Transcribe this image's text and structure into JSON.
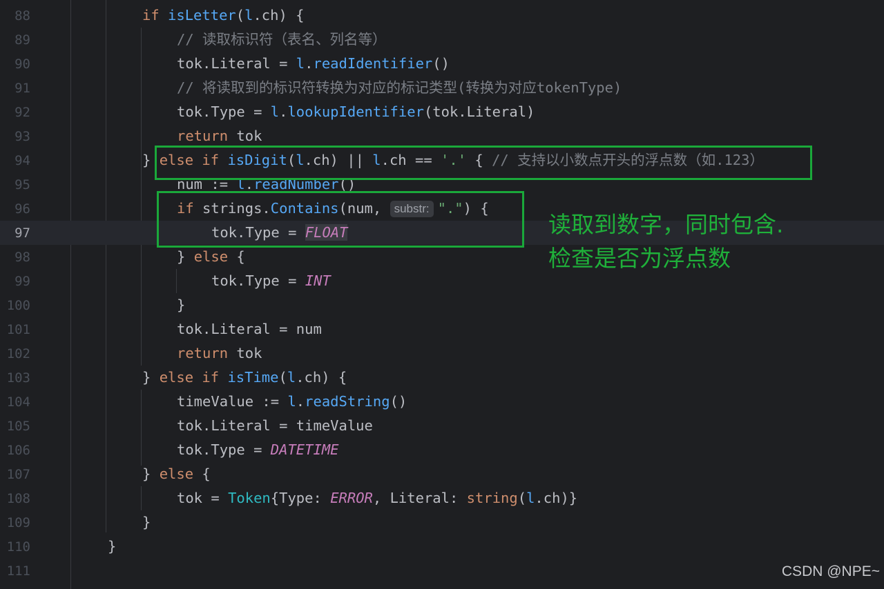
{
  "editor": {
    "line_numbers": [
      "88",
      "89",
      "90",
      "91",
      "92",
      "93",
      "94",
      "95",
      "96",
      "97",
      "98",
      "99",
      "100",
      "101",
      "102",
      "103",
      "104",
      "105",
      "106",
      "107",
      "108",
      "109",
      "110",
      "111"
    ],
    "current_line": "97",
    "code": {
      "l88": {
        "kw": "if",
        "fn": "isLetter",
        "open": "(",
        "recv": "l",
        "rest": ".ch) {"
      },
      "l89": {
        "comment": "// 读取标识符（表名、列名等）"
      },
      "l90": {
        "a": "tok.Literal = ",
        "recv": "l",
        "dot": ".",
        "mth": "readIdentifier",
        "rest": "()"
      },
      "l91": {
        "comment": "// 将读取到的标识符转换为对应的标记类型(转换为对应tokenType)"
      },
      "l92": {
        "a": "tok.Type = ",
        "recv": "l",
        "dot": ".",
        "mth": "lookupIdentifier",
        "rest": "(tok.Literal)"
      },
      "l93": {
        "kw": "return",
        "rest": " tok"
      },
      "l94": {
        "brace": "} ",
        "kw1": "else",
        "sp": " ",
        "kw2": "if",
        "fn": "isDigit",
        "open": "(",
        "recv1": "l",
        "mid": ".ch) || ",
        "recv2": "l",
        "mid2": ".ch == ",
        "str": "'.'",
        "after": " { ",
        "comment": "// 支持以小数点开头的浮点数（如.123）"
      },
      "l95": {
        "a": "num := ",
        "recv": "l",
        "dot": ".",
        "mth": "readNumber",
        "rest": "()"
      },
      "l96": {
        "kw": "if",
        "a": " strings.",
        "fn": "Contains",
        "b": "(num, ",
        "hint": "substr:",
        "str": "\".\"",
        "rest": ") {"
      },
      "l97": {
        "a": "tok.Type = ",
        "cnst": "FLOAT"
      },
      "l98": {
        "brace": "} ",
        "kw": "else",
        "rest": " {"
      },
      "l99": {
        "a": "tok.Type = ",
        "cnst": "INT"
      },
      "l100": {
        "rest": "}"
      },
      "l101": {
        "rest": "tok.Literal = num"
      },
      "l102": {
        "kw": "return",
        "rest": " tok"
      },
      "l103": {
        "brace": "} ",
        "kw1": "else",
        "sp": " ",
        "kw2": "if",
        "fn": "isTime",
        "open": "(",
        "recv": "l",
        "rest": ".ch) {"
      },
      "l104": {
        "a": "timeValue := ",
        "recv": "l",
        "dot": ".",
        "mth": "readString",
        "rest": "()"
      },
      "l105": {
        "rest": "tok.Literal = timeValue"
      },
      "l106": {
        "a": "tok.Type = ",
        "cnst": "DATETIME"
      },
      "l107": {
        "brace": "} ",
        "kw": "else",
        "rest": " {"
      },
      "l108": {
        "a": "tok = ",
        "typ": "Token",
        "b": "{Type: ",
        "cnst": "ERROR",
        "c": ", Literal: ",
        "bi": "string",
        "d": "(",
        "recv": "l",
        "rest": ".ch)}"
      },
      "l109": {
        "rest": "}"
      },
      "l110": {
        "rest": "}"
      },
      "l111": {
        "rest": ""
      }
    }
  },
  "annotation": {
    "line1": "读取到数字，同时包含.",
    "line2": "检查是否为浮点数"
  },
  "watermark": "CSDN @NPE~",
  "colors": {
    "background": "#1e1f22",
    "annotation_green": "#1aa83a",
    "keyword": "#cf8e6d",
    "function": "#56a8f5",
    "string": "#6aab73",
    "comment": "#7a7e85",
    "constant": "#c77dbb"
  }
}
